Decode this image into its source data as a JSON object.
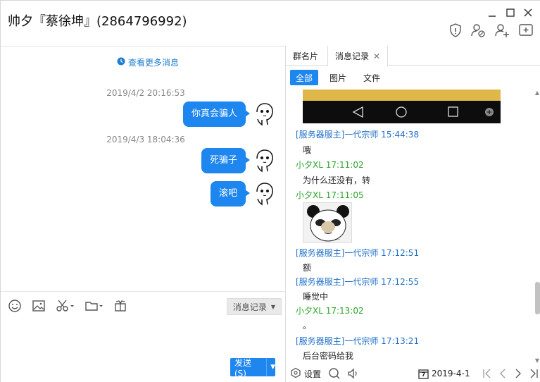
{
  "window": {
    "title": "帅夕『蔡徐坤』(2864796992)"
  },
  "left": {
    "more_link": "查看更多消息",
    "messages": [
      {
        "timestamp": "2019/4/2 20:16:53",
        "text": "你真会骗人"
      },
      {
        "timestamp": "2019/4/3 18:04:36",
        "text": "死骗子"
      },
      {
        "timestamp": "",
        "text": "滚吧"
      }
    ],
    "history_button": "消息记录",
    "send_button": "发送(S)"
  },
  "right": {
    "tabs": [
      "群名片",
      "消息记录"
    ],
    "filter_tabs": [
      "全部",
      "图片",
      "文件"
    ],
    "records": [
      {
        "name": "[服务器服主]一代宗师 15:44:38",
        "msg": "哦",
        "kind": "blue"
      },
      {
        "name": "小夕XL 17:11:02",
        "msg": "为什么还没有，转",
        "kind": "green"
      },
      {
        "name": "小夕XL 17:11:05",
        "msg": "",
        "kind": "green",
        "sticker": true
      },
      {
        "name": "[服务器服主]一代宗师 17:12:51",
        "msg": "额",
        "kind": "blue"
      },
      {
        "name": "[服务器服主]一代宗师 17:12:55",
        "msg": "睡觉中",
        "kind": "blue"
      },
      {
        "name": "小夕XL 17:13:02",
        "msg": "。",
        "kind": "green"
      },
      {
        "name": "[服务器服主]一代宗师 17:13:21",
        "msg": "后台密码给我",
        "kind": "blue"
      }
    ],
    "bottom": {
      "settings_label": "设置",
      "date": "2019-4-1",
      "calendar_day": "7"
    }
  },
  "colors": {
    "accent": "#1e86ef",
    "blue_name": "#1e6fc8",
    "green_name": "#2aa52a"
  }
}
